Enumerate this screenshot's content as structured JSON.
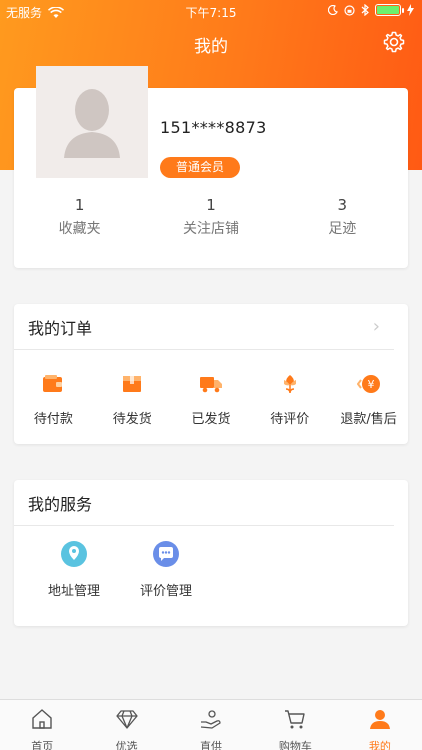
{
  "status_bar": {
    "carrier": "无服务",
    "time": "下午7:15"
  },
  "header": {
    "title": "我的"
  },
  "profile": {
    "phone": "151****8873",
    "member_level": "普通会员",
    "stats": [
      {
        "value": "1",
        "label": "收藏夹"
      },
      {
        "value": "1",
        "label": "关注店铺"
      },
      {
        "value": "3",
        "label": "足迹"
      }
    ]
  },
  "orders": {
    "title": "我的订单",
    "items": [
      {
        "label": "待付款",
        "icon": "wallet-icon"
      },
      {
        "label": "待发货",
        "icon": "box-icon"
      },
      {
        "label": "已发货",
        "icon": "truck-icon"
      },
      {
        "label": "待评价",
        "icon": "flower-icon"
      },
      {
        "label": "退款/售后",
        "icon": "refund-icon"
      }
    ]
  },
  "services": {
    "title": "我的服务",
    "items": [
      {
        "label": "地址管理",
        "icon": "location-icon"
      },
      {
        "label": "评价管理",
        "icon": "chat-icon"
      }
    ]
  },
  "tabbar": {
    "items": [
      {
        "label": "首页",
        "icon": "home-icon"
      },
      {
        "label": "优选",
        "icon": "diamond-icon"
      },
      {
        "label": "直供",
        "icon": "hand-icon"
      },
      {
        "label": "购物车",
        "icon": "cart-icon"
      },
      {
        "label": "我的",
        "icon": "user-icon"
      }
    ],
    "active_index": 4
  },
  "colors": {
    "accent": "#ff7a1a",
    "header_start": "#ff9a1e",
    "header_end": "#ff5a14"
  }
}
